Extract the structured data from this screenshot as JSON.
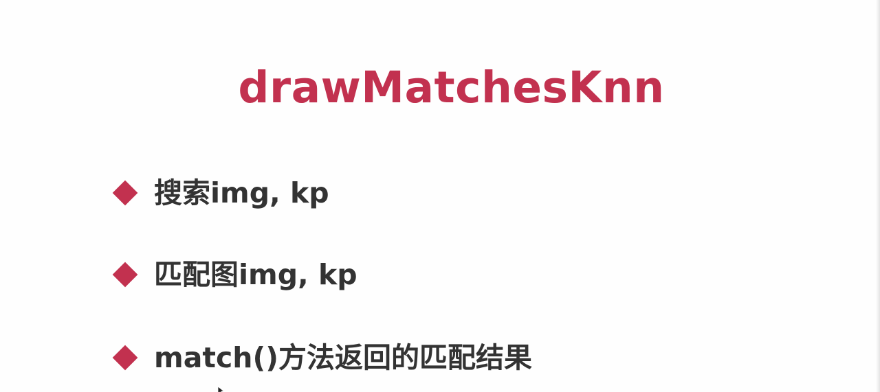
{
  "slide": {
    "title": "drawMatchesKnn",
    "bullets": [
      {
        "icon": "diamond-bullet-icon",
        "text": "搜索img, kp"
      },
      {
        "icon": "diamond-bullet-icon",
        "text": "匹配图img, kp"
      },
      {
        "icon": "diamond-bullet-icon",
        "text": "match()方法返回的匹配结果"
      }
    ],
    "colors": {
      "accent": "#c2314f",
      "text": "#333333",
      "background": "#fefefe"
    }
  }
}
